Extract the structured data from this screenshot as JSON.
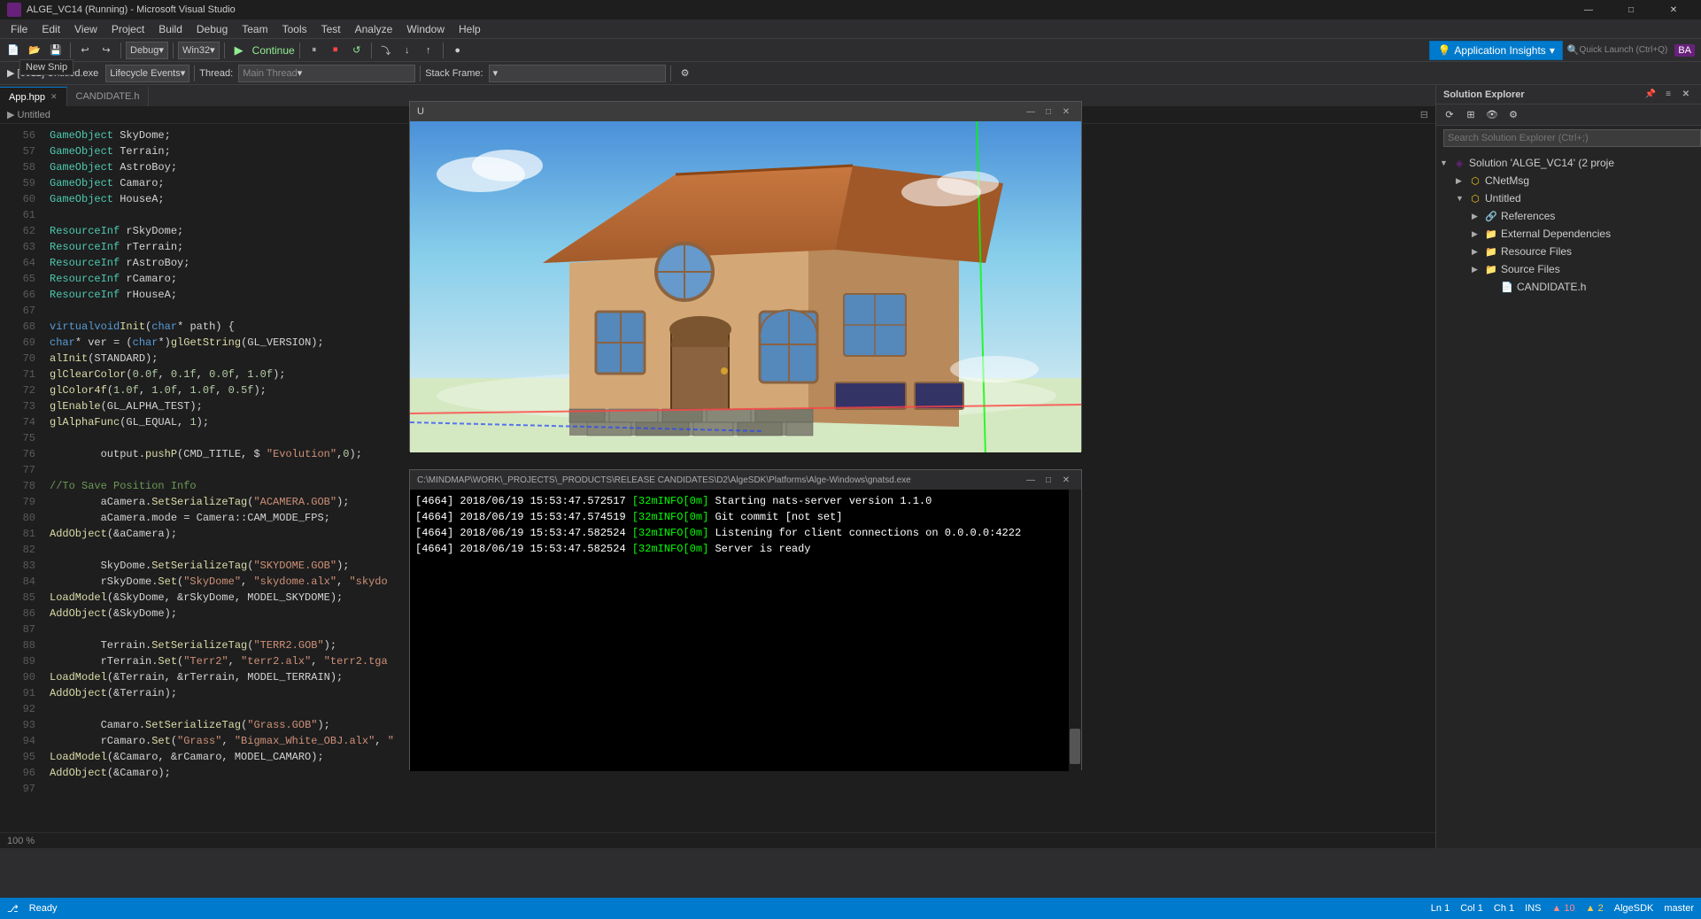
{
  "titlebar": {
    "title": "ALGE_VC14 (Running) - Microsoft Visual Studio",
    "min": "—",
    "max": "□",
    "close": "✕"
  },
  "menu": {
    "items": [
      "File",
      "Edit",
      "View",
      "Project",
      "Build",
      "Debug",
      "Team",
      "Tools",
      "Test",
      "Analyze",
      "Window",
      "Help"
    ]
  },
  "toolbar": {
    "config": "Debug",
    "platform": "Win32",
    "continue": "Continue",
    "app_insights": "Application Insights",
    "new_snip": "New Snip"
  },
  "debug_toolbar": {
    "lifecycle": "Lifecycle Events",
    "thread_label": "Thread:",
    "stack_frame": "Stack Frame:"
  },
  "tabs": {
    "items": [
      {
        "label": "App.hpp",
        "active": true,
        "close": true
      },
      {
        "label": "CANDIDATE.h",
        "active": false,
        "close": false
      }
    ]
  },
  "code": {
    "lines": [
      {
        "num": 56,
        "content": "    GameObject SkyDome;"
      },
      {
        "num": 57,
        "content": "    GameObject Terrain;"
      },
      {
        "num": 58,
        "content": "    GameObject AstroBoy;"
      },
      {
        "num": 59,
        "content": "    GameObject Camaro;"
      },
      {
        "num": 60,
        "content": "    GameObject HouseA;"
      },
      {
        "num": 61,
        "content": ""
      },
      {
        "num": 62,
        "content": "    ResourceInf rSkyDome;"
      },
      {
        "num": 63,
        "content": "    ResourceInf rTerrain;"
      },
      {
        "num": 64,
        "content": "    ResourceInf rAstroBoy;"
      },
      {
        "num": 65,
        "content": "    ResourceInf rCamaro;"
      },
      {
        "num": 66,
        "content": "    ResourceInf rHouseA;"
      },
      {
        "num": 67,
        "content": ""
      },
      {
        "num": 68,
        "content": "    virtual void Init(char* path) {"
      },
      {
        "num": 69,
        "content": "        char* ver = (char*)glGetString(GL_VERSION);"
      },
      {
        "num": 70,
        "content": "        alInit(STANDARD);"
      },
      {
        "num": 71,
        "content": "        glClearColor(0.0f, 0.1f, 0.0f, 1.0f);"
      },
      {
        "num": 72,
        "content": "        glColor4f(1.0f, 1.0f, 1.0f, 0.5f);"
      },
      {
        "num": 73,
        "content": "        glEnable(GL_ALPHA_TEST);"
      },
      {
        "num": 74,
        "content": "        glAlphaFunc(GL_EQUAL, 1);"
      },
      {
        "num": 75,
        "content": ""
      },
      {
        "num": 76,
        "content": "        output.pushP(CMD_TITLE, $ \"Evolution\",0);"
      },
      {
        "num": 77,
        "content": ""
      },
      {
        "num": 78,
        "content": "        //To Save Position Info"
      },
      {
        "num": 79,
        "content": "        aCamera.SetSerializeTag(\"ACAMERA.GOB\");"
      },
      {
        "num": 80,
        "content": "        aCamera.mode = Camera::CAM_MODE_FPS;"
      },
      {
        "num": 81,
        "content": "        AddObject(&aCamera);"
      },
      {
        "num": 82,
        "content": ""
      },
      {
        "num": 83,
        "content": "        SkyDome.SetSerializeTag(\"SKYDOME.GOB\");"
      },
      {
        "num": 84,
        "content": "        rSkyDome.Set(\"SkyDome\", \"skydome.alx\", \"skydo"
      },
      {
        "num": 85,
        "content": "        LoadModel(&SkyDome, &rSkyDome, MODEL_SKYDOME);"
      },
      {
        "num": 86,
        "content": "        AddObject(&SkyDome);"
      },
      {
        "num": 87,
        "content": ""
      },
      {
        "num": 88,
        "content": "        Terrain.SetSerializeTag(\"TERR2.GOB\");"
      },
      {
        "num": 89,
        "content": "        rTerrain.Set(\"Terr2\", \"terr2.alx\", \"terr2.tga"
      },
      {
        "num": 90,
        "content": "        LoadModel(&Terrain, &rTerrain, MODEL_TERRAIN);"
      },
      {
        "num": 91,
        "content": "        AddObject(&Terrain);"
      },
      {
        "num": 92,
        "content": ""
      },
      {
        "num": 93,
        "content": "        Camaro.SetSerializeTag(\"Grass.GOB\");"
      },
      {
        "num": 94,
        "content": "        rCamaro.Set(\"Grass\", \"Bigmax_White_OBJ.alx\", \""
      },
      {
        "num": 95,
        "content": "        LoadModel(&Camaro, &rCamaro, MODEL_CAMARO);"
      },
      {
        "num": 96,
        "content": "        AddObject(&Camaro);"
      }
    ]
  },
  "solution_explorer": {
    "title": "Solution Explorer",
    "search_placeholder": "Search Solution Explorer (Ctrl+;)",
    "tree": [
      {
        "level": 0,
        "label": "Solution 'ALGE_VC14' (2 proje",
        "icon": "solution",
        "expanded": true
      },
      {
        "level": 1,
        "label": "CNetMsg",
        "icon": "project",
        "expanded": false
      },
      {
        "level": 1,
        "label": "Untitled",
        "icon": "project",
        "expanded": true
      },
      {
        "level": 2,
        "label": "References",
        "icon": "folder",
        "expanded": false
      },
      {
        "level": 2,
        "label": "External Dependencies",
        "icon": "folder",
        "expanded": false
      },
      {
        "level": 2,
        "label": "Resource Files",
        "icon": "folder",
        "expanded": false
      },
      {
        "level": 2,
        "label": "Source Files",
        "icon": "folder",
        "expanded": false
      },
      {
        "level": 3,
        "label": "CANDIDATE.h",
        "icon": "file",
        "expanded": false
      }
    ]
  },
  "viewport": {
    "title": "U",
    "path": "C:\\MINDMAP\\WORK\\_PROJECTS\\_PRODUCTS\\RELEASE CANDIDATES\\D2\\AlgeSDK\\Platforms\\Alge-Windows\\gnatsd.exe"
  },
  "console": {
    "title": "C:\\MINDMAP\\WORK\\_PROJECTS\\_PRODUCTS\\RELEASE CANDIDATES\\D2\\AlgeSDK\\Platforms\\Alge-Windows\\gnatsd.exe",
    "lines": [
      {
        "pid": "[4664]",
        "ts": "2018/06/19 15:53:47.572517",
        "level": "[32mINFO[0m]",
        "msg": "Starting nats-server version 1.1.0"
      },
      {
        "pid": "[4664]",
        "ts": "2018/06/19 15:53:47.574519",
        "level": "[32mINFO[0m]",
        "msg": "Git commit [not set]"
      },
      {
        "pid": "[4664]",
        "ts": "2018/06/19 15:53:47.582524",
        "level": "[32mINFO[0m]",
        "msg": "Listening for client connections on 0.0.0.0:4222"
      },
      {
        "pid": "[4664]",
        "ts": "2018/06/19 15:53:47.582524",
        "level": "[32mINFO[0m]",
        "msg": "Server is ready"
      }
    ]
  },
  "statusbar": {
    "ready": "Ready",
    "ln": "Ln 1",
    "col": "Col 1",
    "ch": "Ch 1",
    "ins": "INS",
    "zoom": "100 %",
    "errors": "▲ 10",
    "warnings": "▲ 2",
    "algesdk": "AlgeSDK",
    "branch": "master"
  }
}
